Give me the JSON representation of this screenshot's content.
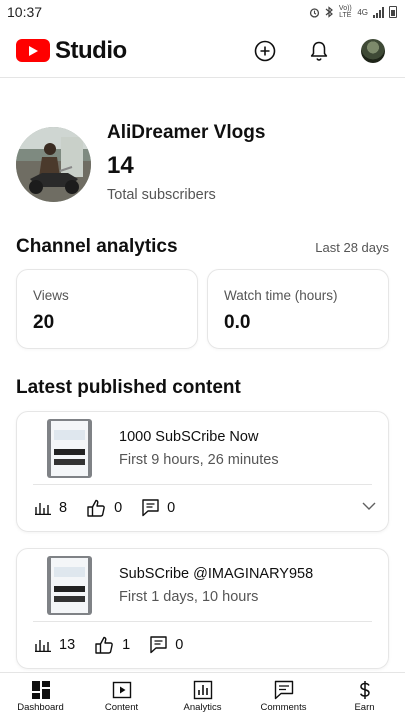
{
  "status_bar": {
    "time": "10:37",
    "icons": [
      "alarm-icon",
      "bluetooth-icon",
      "volte-icon",
      "4g-icon",
      "signal-icon",
      "battery-icon"
    ],
    "volte_text": "Vo)) LTE",
    "network_text": "4G"
  },
  "header": {
    "app_name": "Studio",
    "brand_color": "#ff0000",
    "actions": [
      "create-icon",
      "notifications-icon",
      "account-avatar"
    ]
  },
  "channel": {
    "name": "AliDreamer Vlogs",
    "subscriber_count": "14",
    "subscriber_label": "Total subscribers"
  },
  "analytics": {
    "title": "Channel analytics",
    "period": "Last 28 days",
    "metrics": [
      {
        "label": "Views",
        "value": "20"
      },
      {
        "label": "Watch time (hours)",
        "value": "0.0"
      }
    ]
  },
  "latest": {
    "title": "Latest published content",
    "items": [
      {
        "title": "1000 SubSCribe Now",
        "subtitle": "First 9 hours, 26 minutes",
        "views": "8",
        "likes": "0",
        "comments": "0"
      },
      {
        "title": "SubSCribe @IMAGINARY958",
        "subtitle": "First 1 days, 10 hours",
        "views": "13",
        "likes": "1",
        "comments": "0"
      }
    ]
  },
  "nav": {
    "items": [
      {
        "label": "Dashboard",
        "icon": "dashboard-icon",
        "active": true
      },
      {
        "label": "Content",
        "icon": "content-icon",
        "active": false
      },
      {
        "label": "Analytics",
        "icon": "analytics-icon",
        "active": false
      },
      {
        "label": "Comments",
        "icon": "comments-icon",
        "active": false
      },
      {
        "label": "Earn",
        "icon": "earn-icon",
        "active": false
      }
    ]
  }
}
